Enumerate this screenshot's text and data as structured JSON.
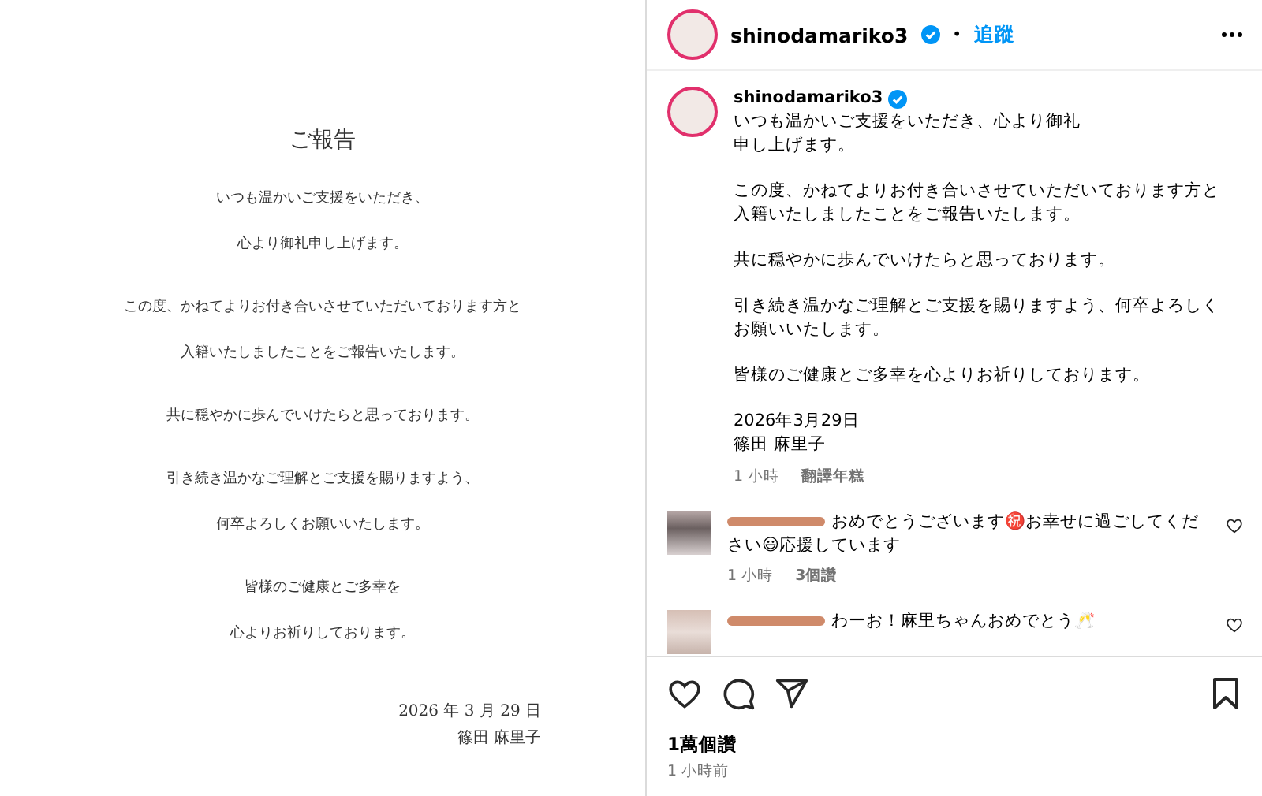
{
  "post_image": {
    "title": "ご報告",
    "paragraphs": [
      [
        "いつも温かいご支援をいただき、",
        "心より御礼申し上げます。"
      ],
      [
        "この度、かねてよりお付き合いさせていただいております方と",
        "入籍いたしましたことをご報告いたします。"
      ],
      [
        "共に穏やかに歩んでいけたらと思っております。"
      ],
      [
        "引き続き温かなご理解とご支援を賜りますよう、",
        "何卒よろしくお願いいたします。"
      ],
      [
        "皆様のご健康とご多幸を",
        "心よりお祈りしております。"
      ]
    ],
    "date": "2026 年 3 月 29 日",
    "signature": "篠田 麻里子"
  },
  "header": {
    "username": "shinodamariko3",
    "verified": true,
    "separator": "•",
    "follow": "追蹤"
  },
  "caption": {
    "username": "shinodamariko3",
    "verified": true,
    "paragraphs": [
      [
        "いつも温かいご支援をいただき、心より御礼",
        "申し上げます。"
      ],
      [
        "この度、かねてよりお付き合いさせていただいております方と",
        "入籍いたしましたことをご報告いたします。"
      ],
      [
        "共に穏やかに歩んでいけたらと思っております。"
      ],
      [
        "引き続き温かなご理解とご支援を賜りますよう、何卒よろしく",
        "お願いいたします。"
      ],
      [
        "皆様のご健康とご多幸を心よりお祈りしております。"
      ],
      [
        "2026年3月29日",
        "篠田 麻里子"
      ]
    ],
    "time": "1 小時",
    "translate": "翻譯年糕"
  },
  "comments": [
    {
      "text": "おめでとうございます㊗️お幸せに過ごしてください😃応援しています",
      "time": "1 小時",
      "likes": "3個讚"
    },
    {
      "text": "わーお！麻里ちゃんおめでとう🥂"
    }
  ],
  "likes": "1萬個讚",
  "posted": "1 小時前"
}
